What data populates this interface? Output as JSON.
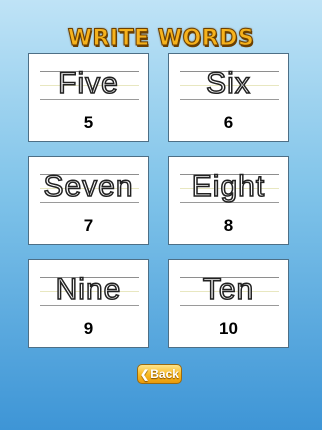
{
  "title": "WRITE WORDS",
  "cards": [
    {
      "word": "Five",
      "number": "5"
    },
    {
      "word": "Six",
      "number": "6"
    },
    {
      "word": "Seven",
      "number": "7"
    },
    {
      "word": "Eight",
      "number": "8"
    },
    {
      "word": "Nine",
      "number": "9"
    },
    {
      "word": "Ten",
      "number": "10"
    }
  ],
  "back_button": {
    "label": "Back",
    "icon": "chevron-left-icon"
  }
}
